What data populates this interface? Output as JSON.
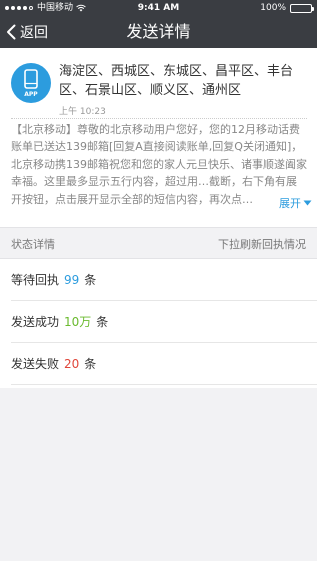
{
  "status_bar": {
    "carrier": "中国移动",
    "time": "9:41 AM",
    "battery": "100%"
  },
  "nav": {
    "back_label": "返回",
    "title": "发送详情"
  },
  "message": {
    "app_icon_label": "APP",
    "recipients": "海淀区、西城区、东城区、昌平区、丰台区、石景山区、顺义区、通州区",
    "time": "上午 10:23",
    "body": "【北京移动】尊敬的北京移动用户您好，您的12月移动话费账单已送达139邮箱[回复A直接阅读账单,回复Q关闭通知]，北京移动携139邮箱祝您和您的家人元旦快乐、诸事顺遂阖家幸福。这里最多显示五行内容，超过用…截断，右下角有展开按钮，点击展开显示全部的短信内容，再次点…",
    "expand_label": "展开"
  },
  "status_section": {
    "title": "状态详情",
    "refresh_hint": "下拉刷新回执情况"
  },
  "status_rows": [
    {
      "label": "等待回执",
      "count": "99",
      "unit": "条",
      "color": "#2c9cde"
    },
    {
      "label": "发送成功",
      "count": "10万",
      "unit": "条",
      "color": "#6aba2e"
    },
    {
      "label": "发送失败",
      "count": "20",
      "unit": "条",
      "color": "#e0463a"
    }
  ],
  "colors": {
    "nav_background": "#3a3d42",
    "accent": "#2c9cde",
    "success": "#6aba2e",
    "failure": "#e0463a"
  }
}
